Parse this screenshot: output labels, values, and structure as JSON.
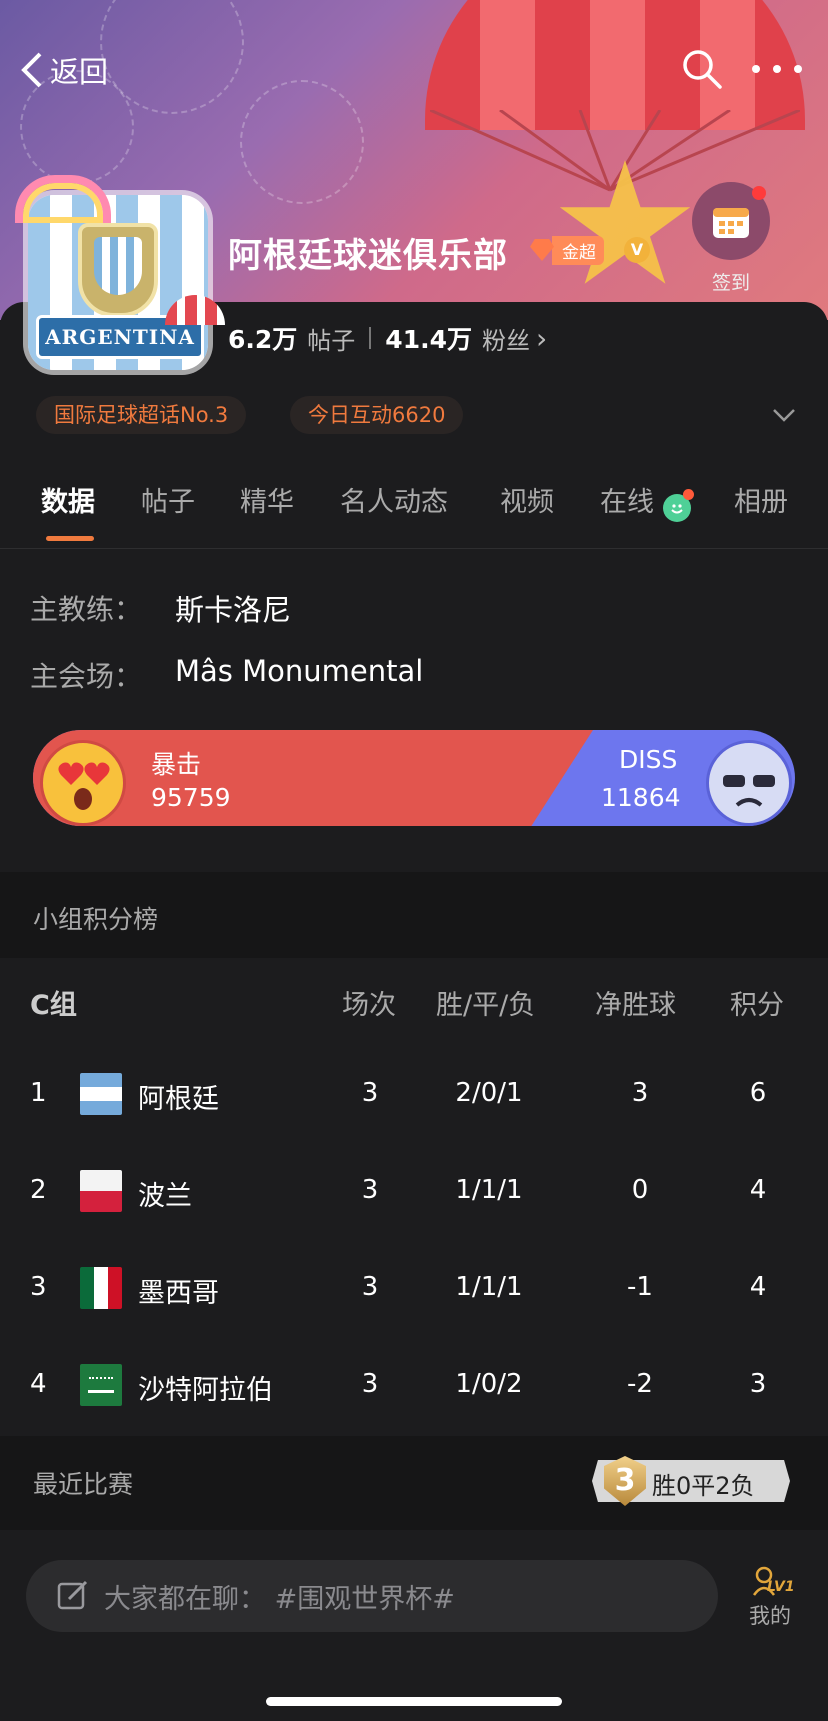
{
  "topbar": {
    "back_label": "返回"
  },
  "club": {
    "name": "阿根廷球迷俱乐部",
    "badge_level": "2",
    "badge_label": "金超",
    "verified": "V",
    "avatar_text": "ARGENTINA",
    "checkin_label": "签到"
  },
  "stats": {
    "posts_value": "6.2万",
    "posts_label": "帖子",
    "fans_value": "41.4万",
    "fans_label": "粉丝",
    "fans_chevron": "›"
  },
  "tags": [
    "国际足球超话No.3",
    "今日互动6620"
  ],
  "tabs": [
    "数据",
    "帖子",
    "精华",
    "名人动态",
    "视频",
    "在线",
    "相册"
  ],
  "info": {
    "coach_label": "主教练：",
    "coach_value": "斯卡洛尼",
    "venue_label": "主会场：",
    "venue_value": "Mâs Monumental"
  },
  "vote": {
    "left_label": "暴击",
    "left_value": "95759",
    "right_label": "DISS",
    "right_value": "11864"
  },
  "standings": {
    "section_title": "小组积分榜",
    "group": "C组",
    "headers": [
      "场次",
      "胜/平/负",
      "净胜球",
      "积分"
    ],
    "rows": [
      {
        "rank": "1",
        "team": "阿根廷",
        "played": "3",
        "wdl": "2/0/1",
        "gd": "3",
        "pts": "6"
      },
      {
        "rank": "2",
        "team": "波兰",
        "played": "3",
        "wdl": "1/1/1",
        "gd": "0",
        "pts": "4"
      },
      {
        "rank": "3",
        "team": "墨西哥",
        "played": "3",
        "wdl": "1/1/1",
        "gd": "-1",
        "pts": "4"
      },
      {
        "rank": "4",
        "team": "沙特阿拉伯",
        "played": "3",
        "wdl": "1/0/2",
        "gd": "-2",
        "pts": "3"
      }
    ]
  },
  "recent": {
    "title": "最近比赛",
    "badge_number": "3",
    "record_text": "胜0平2负"
  },
  "bottom": {
    "input_text": "大家都在聊：  #围观世界杯#",
    "me_level": "LV1",
    "me_label": "我的"
  },
  "colors": {
    "accent": "#f07a3e",
    "vote_red": "#e2554e",
    "vote_blue": "#6d76ee"
  }
}
